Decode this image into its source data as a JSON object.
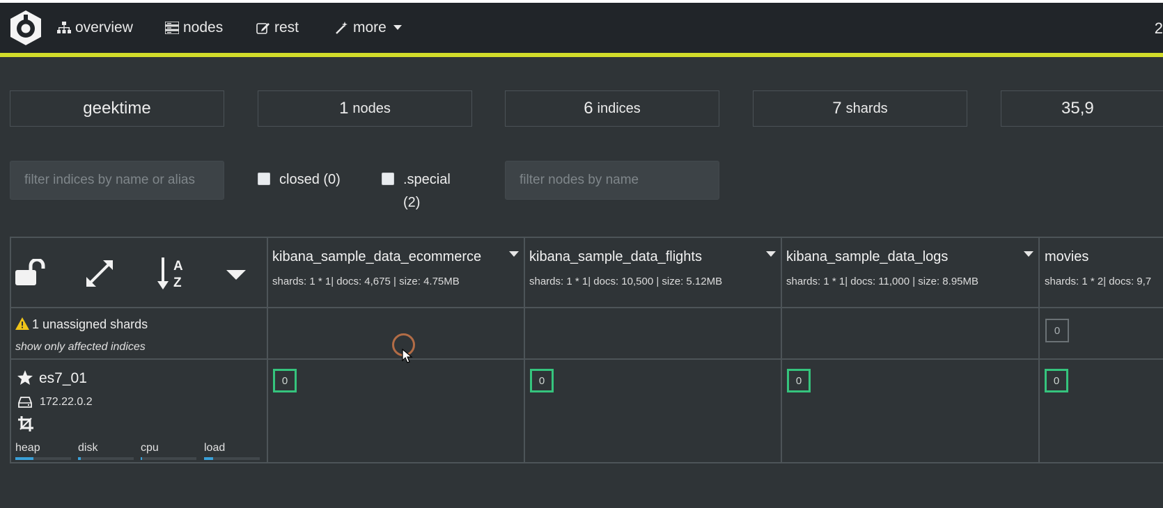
{
  "nav": {
    "items": [
      {
        "label": "overview",
        "icon": "sitemap-icon"
      },
      {
        "label": "nodes",
        "icon": "server-icon"
      },
      {
        "label": "rest",
        "icon": "edit-icon"
      },
      {
        "label": "more",
        "icon": "magic-wand-icon"
      }
    ],
    "accent_color": "#d2dc2a"
  },
  "stats": {
    "cluster_name": "geektime",
    "nodes_value": "1",
    "nodes_label": "nodes",
    "indices_value": "6",
    "indices_label": "indices",
    "shards_value": "7",
    "shards_label": "shards",
    "docs_value": "35,9"
  },
  "filters": {
    "indices_placeholder": "filter indices by name or alias",
    "closed_label": "closed (0)",
    "special_label_1": ".special",
    "special_label_2": "(2)",
    "nodes_placeholder": "filter nodes by name"
  },
  "indices": [
    {
      "name": "kibana_sample_data_ecommerce",
      "meta": "shards: 1 * 1| docs: 4,675 | size: 4.75MB",
      "shard": "0"
    },
    {
      "name": "kibana_sample_data_flights",
      "meta": "shards: 1 * 1| docs: 10,500 | size: 5.12MB",
      "shard": "0"
    },
    {
      "name": "kibana_sample_data_logs",
      "meta": "shards: 1 * 1| docs: 11,000 | size: 8.95MB",
      "shard": "0"
    },
    {
      "name": "movies",
      "meta": "shards: 1 * 2| docs: 9,7",
      "shard": "0",
      "unassigned": "0"
    }
  ],
  "unassigned": {
    "text": "1 unassigned shards",
    "link": "show only affected indices"
  },
  "node": {
    "name": "es7_01",
    "ip": "172.22.0.2",
    "metrics": [
      {
        "label": "heap",
        "level": 0.32
      },
      {
        "label": "disk",
        "level": 0.05
      },
      {
        "label": "cpu",
        "level": 0.02
      },
      {
        "label": "load",
        "level": 0.16
      }
    ]
  },
  "colors": {
    "shard_started": "#35c47d",
    "metric_bar": "#3aa0d8",
    "warning": "#f0c419"
  }
}
